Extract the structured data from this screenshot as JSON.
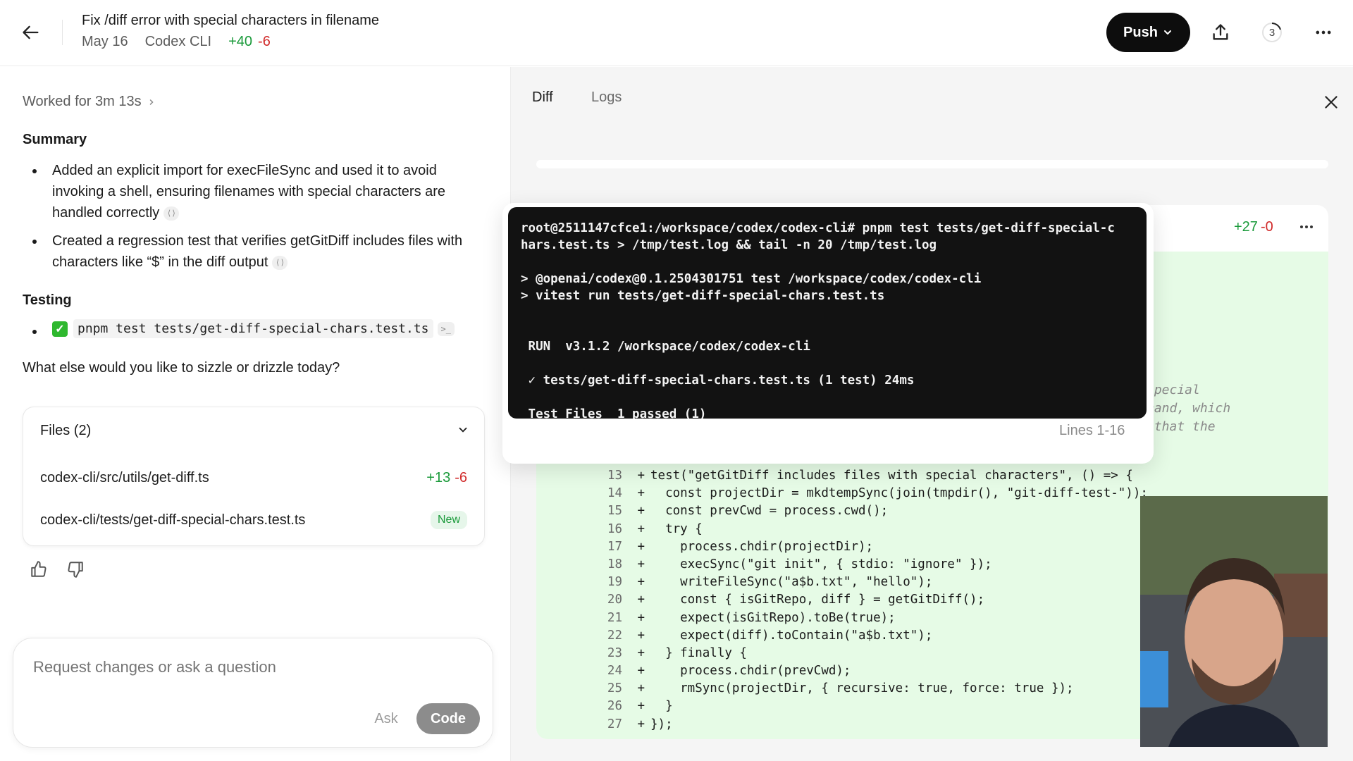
{
  "header": {
    "title": "Fix /diff error with special characters in filename",
    "date": "May 16",
    "source": "Codex CLI",
    "additions": "+40",
    "deletions": "-6",
    "push_label": "Push",
    "count": "3"
  },
  "left": {
    "worked": "Worked for 3m 13s",
    "summary_heading": "Summary",
    "summary_items": [
      "Added an explicit import for execFileSync and used it to avoid invoking a shell, ensuring filenames with special characters are handled correctly",
      "Created a regression test that verifies getGitDiff includes files with characters like “$” in the diff output"
    ],
    "testing_heading": "Testing",
    "test_command": "pnpm test tests/get-diff-special-chars.test.ts",
    "question": "What else would you like to sizzle or drizzle today?",
    "files": {
      "heading": "Files (2)",
      "rows": [
        {
          "path": "codex-cli/src/utils/get-diff.ts",
          "add": "+13",
          "del": "-6"
        },
        {
          "path": "codex-cli/tests/get-diff-special-chars.test.ts",
          "badge": "New"
        }
      ]
    },
    "input_placeholder": "Request changes or ask a question",
    "ask_label": "Ask",
    "code_label": "Code"
  },
  "right": {
    "tabs": [
      "Diff",
      "Logs"
    ],
    "diff_stat_add": "+27",
    "diff_stat_del": "-0",
    "comment_fragment": [
      "special",
      "mand, which",
      " that the"
    ],
    "lines_label": "Lines 1-16",
    "terminal": [
      "root@2511147cfce1:/workspace/codex/codex-cli# pnpm test tests/get-diff-special-c",
      "hars.test.ts > /tmp/test.log && tail -n 20 /tmp/test.log",
      "",
      "> @openai/codex@0.1.2504301751 test /workspace/codex/codex-cli",
      "> vitest run tests/get-diff-special-chars.test.ts",
      "",
      "",
      " RUN  v3.1.2 /workspace/codex/codex-cli",
      "",
      " ✓ tests/get-diff-special-chars.test.ts (1 test) 24ms",
      "",
      " Test Files  1 passed (1)"
    ],
    "code_lines": [
      {
        "n": "13",
        "t": "test(\"getGitDiff includes files with special characters\", () => {"
      },
      {
        "n": "14",
        "t": "  const projectDir = mkdtempSync(join(tmpdir(), \"git-diff-test-\"));"
      },
      {
        "n": "15",
        "t": "  const prevCwd = process.cwd();"
      },
      {
        "n": "16",
        "t": "  try {"
      },
      {
        "n": "17",
        "t": "    process.chdir(projectDir);"
      },
      {
        "n": "18",
        "t": "    execSync(\"git init\", { stdio: \"ignore\" });"
      },
      {
        "n": "19",
        "t": "    writeFileSync(\"a$b.txt\", \"hello\");"
      },
      {
        "n": "20",
        "t": "    const { isGitRepo, diff } = getGitDiff();"
      },
      {
        "n": "21",
        "t": "    expect(isGitRepo).toBe(true);"
      },
      {
        "n": "22",
        "t": "    expect(diff).toContain(\"a$b.txt\");"
      },
      {
        "n": "23",
        "t": "  } finally {"
      },
      {
        "n": "24",
        "t": "    process.chdir(prevCwd);"
      },
      {
        "n": "25",
        "t": "    rmSync(projectDir, { recursive: true, force: true });"
      },
      {
        "n": "26",
        "t": "  }"
      },
      {
        "n": "27",
        "t": "});"
      }
    ]
  },
  "icons": {
    "back": "arrow-left-icon",
    "share": "share-upload-icon",
    "more": "more-horizontal-icon",
    "close": "close-icon",
    "thumbs_up": "thumbs-up-icon",
    "thumbs_down": "thumbs-down-icon"
  },
  "colors": {
    "add": "#1a9a3a",
    "del": "#d12b2b",
    "diff_bg": "#e6fbe6",
    "terminal_bg": "#121212",
    "push_bg": "#0d0d0d"
  }
}
